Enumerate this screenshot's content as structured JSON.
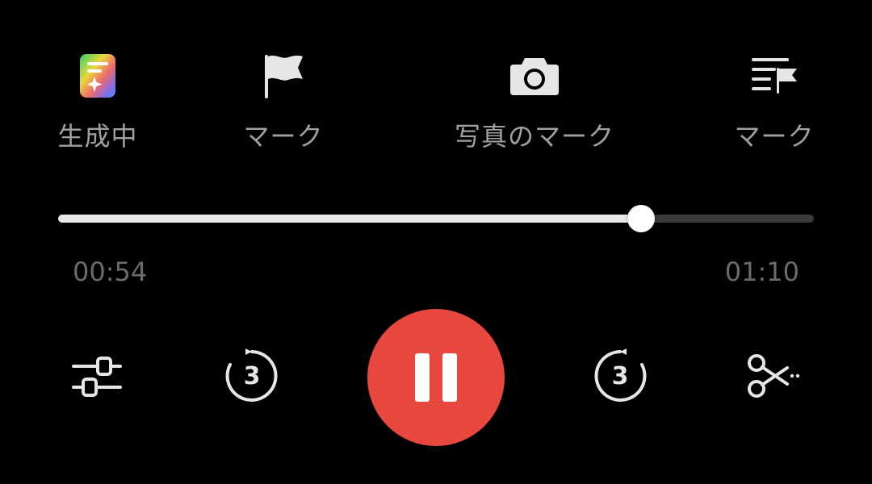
{
  "top_actions": {
    "generating": {
      "label": "生成中",
      "icon": "ai-notes-icon"
    },
    "mark": {
      "label": "マーク",
      "icon": "flag-icon"
    },
    "photo_mark": {
      "label": "写真のマーク",
      "icon": "camera-icon"
    },
    "mark_list": {
      "label": "マーク",
      "icon": "mark-list-icon"
    }
  },
  "playback": {
    "current_time": "00:54",
    "total_time": "01:10",
    "progress_fraction": 0.771
  },
  "controls": {
    "settings_icon": "sliders-icon",
    "rewind_seconds": "3",
    "play_state_icon": "pause-icon",
    "forward_seconds": "3",
    "cut_icon": "scissors-icon"
  },
  "colors": {
    "background": "#000000",
    "accent": "#e8473f",
    "progress_fill": "#e8e8e8",
    "progress_track": "#3a3a3a",
    "label_text": "#a0a0a0",
    "time_text": "#6b6b6b"
  }
}
